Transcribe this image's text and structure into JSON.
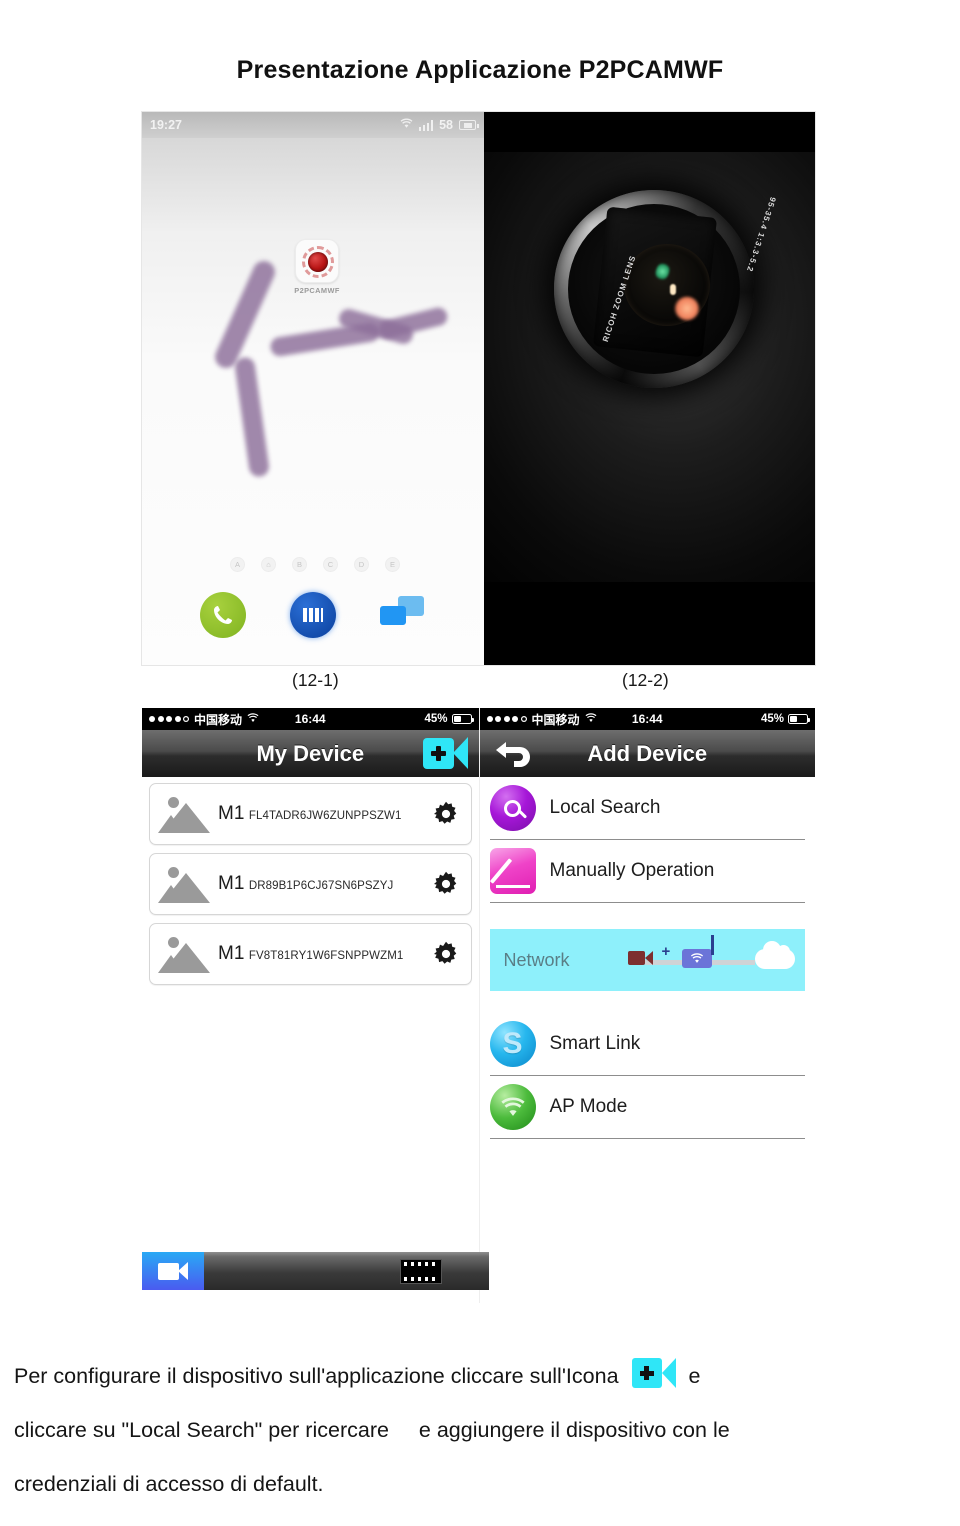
{
  "document": {
    "title": "Presentazione Applicazione P2PCAMWF"
  },
  "figures": {
    "caption_left": "(12-1)",
    "caption_right": "(12-2)"
  },
  "android_home": {
    "status_bar": {
      "time": "19:27",
      "wifi_icon": "wifi-icon",
      "signal_icon": "signal-bars-icon",
      "signal_value": "58",
      "battery_icon": "battery-icon"
    },
    "app_icon": {
      "label": "P2PCAMWF",
      "icon": "p2pcamwf-app-icon"
    },
    "page_indicators": [
      "A",
      "⌂",
      "B",
      "C",
      "D",
      "E"
    ],
    "dock": [
      {
        "name": "phone-icon",
        "glyph": "✆"
      },
      {
        "name": "cards-icon",
        "glyph": ""
      },
      {
        "name": "messages-icon",
        "glyph": ""
      }
    ]
  },
  "camera_photo": {
    "lens_text_left": "RICOH ZOOM LENS",
    "lens_text_right": "95-35.4  1:3.3-5.2"
  },
  "ios_my_device": {
    "status_bar": {
      "carrier": "中国移动",
      "wifi_icon": "wifi-icon",
      "time": "16:44",
      "battery_percent": "45%"
    },
    "nav": {
      "title": "My Device",
      "add_button_icon": "camera-plus-icon"
    },
    "devices": [
      {
        "name": "M1",
        "uid": "FL4TADR6JW6ZUNPPSZW1",
        "settings_icon": "gear-icon"
      },
      {
        "name": "M1",
        "uid": "DR89B1P6CJ67SN6PSZYJ",
        "settings_icon": "gear-icon"
      },
      {
        "name": "M1",
        "uid": "FV8T81RY1W6FSNPPWZM1",
        "settings_icon": "gear-icon"
      }
    ],
    "toolbar": {
      "camera_tab_icon": "camera-tab-icon",
      "gallery_tab_icon": "film-strip-icon"
    }
  },
  "ios_add_device": {
    "status_bar": {
      "carrier": "中国移动",
      "wifi_icon": "wifi-icon",
      "time": "16:44",
      "battery_percent": "45%"
    },
    "nav": {
      "title": "Add Device",
      "back_button_icon": "back-arrow-icon"
    },
    "options": [
      {
        "label": "Local Search",
        "icon": "magnifier-icon"
      },
      {
        "label": "Manually Operation",
        "icon": "pencil-icon"
      }
    ],
    "network_section": {
      "label": "Network",
      "diagram_icons": [
        "camera-icon",
        "plus-icon",
        "router-icon",
        "cloud-icon"
      ]
    },
    "network_options": [
      {
        "label": "Smart Link",
        "icon": "smart-link-icon",
        "glyph": "S"
      },
      {
        "label": "AP Mode",
        "icon": "ap-mode-wifi-icon",
        "glyph": "ᵞ"
      }
    ]
  },
  "body_text": {
    "line1_a": "Per configurare il dispositivo sull'applicazione cliccare sull'Icona",
    "line1_b": "e",
    "line2_a": "cliccare su \"Local Search\" per ricercare",
    "line2_b": "e aggiungere il dispositivo con le",
    "line3": "credenziali di accesso di default."
  },
  "colors": {
    "accent_cyan": "#2fe6f7",
    "network_banner": "#8ef0fb",
    "local_search_purple": "#a617d8",
    "manual_pink": "#ef43c8",
    "smart_link_blue": "#27b7ee",
    "ap_mode_green": "#4cbb3c"
  }
}
